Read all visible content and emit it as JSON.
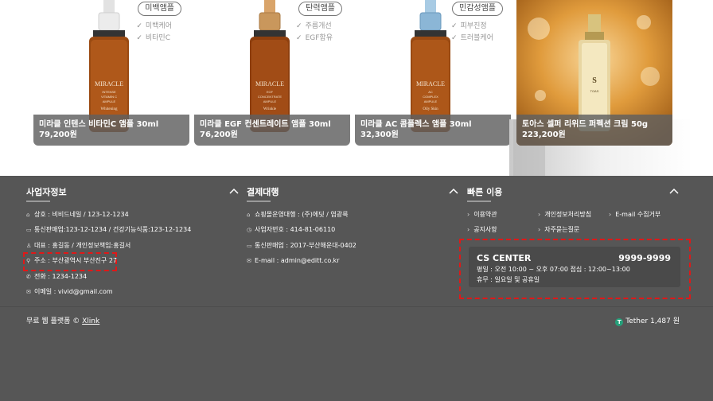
{
  "products": [
    {
      "badge": "미백앰플",
      "features": [
        "미백케어",
        "비타민C"
      ],
      "name": "미라클 인텐스 비타민C 앰플 30ml",
      "price": "79,200원",
      "bottle_label": "MIRACLE INTENSE VITAMIN C AMPULE",
      "bottle_sub": "Whitening",
      "cap_color": "#e8e8e8"
    },
    {
      "badge": "탄력앰플",
      "features": [
        "주름개선",
        "EGF함유"
      ],
      "name": "미라클 EGF 컨센트레이트 앰플 30ml",
      "price": "76,200원",
      "bottle_label": "MIRACLE EGF CONCENTRATE AMPULE",
      "bottle_sub": "Wrinkle",
      "cap_color": "#c9975c"
    },
    {
      "badge": "민감성앰플",
      "features": [
        "피부진정",
        "트러블케어"
      ],
      "name": "미라클 AC 콤플렉스 앰플 30ml",
      "price": "32,300원",
      "bottle_label": "MIRACLE AC COMPLEX AMPULE",
      "bottle_sub": "Oily Skin",
      "cap_color": "#8bb6d6"
    },
    {
      "badge": "",
      "features": [],
      "name": "토아스 셀퍼 리위드 퍼펙션 크림 50g",
      "price": "223,200원",
      "bottle_label": "TOAS",
      "bottle_sub": "",
      "cap_color": "#c7a95a"
    }
  ],
  "footer": {
    "business": {
      "title": "사업자정보",
      "lines": [
        {
          "icon": "home-icon",
          "text": "상호 : 비비드네일 / 123-12-1234"
        },
        {
          "icon": "card-icon",
          "text": "통신판매업:123-12-1234 / 건강기능식품:123-12-1234"
        },
        {
          "icon": "person-icon",
          "text": "대표 : 홍길동 / 개인정보책임:홍길서"
        },
        {
          "icon": "pin-icon",
          "text": "주소 : 부산광역시 부산진구 27"
        },
        {
          "icon": "phone-icon",
          "text": "전화 : 1234-1234"
        },
        {
          "icon": "mail-icon",
          "text": "이메일 : vivid@gmail.com"
        }
      ]
    },
    "settlement": {
      "title": "결제대행",
      "lines": [
        {
          "icon": "home-icon",
          "text": "쇼핑몰운영대행 : (주)에딧 / 염광룩"
        },
        {
          "icon": "clock-icon",
          "text": "사업자번호 : 414-81-06110"
        },
        {
          "icon": "card-icon",
          "text": "통신판매업 : 2017-부산해운대-0402"
        },
        {
          "icon": "mail-icon",
          "text": "E-mail : admin@editt.co.kr"
        }
      ]
    },
    "quick": {
      "title": "빠른 이용",
      "links": [
        "이용약관",
        "개인정보처리방침",
        "E-mail 수집거부",
        "공지사항",
        "자주묻는질문"
      ]
    },
    "cs": {
      "title": "CS CENTER",
      "phone": "9999-9999",
      "hours": "평일 : 오전 10:00 ~ 오후 07:00    점심 : 12:00~13:00",
      "holiday": "휴무 : 일요일 및 공휴일"
    },
    "copyright_prefix": "무료 웹 플랫폼 © ",
    "copyright_link": "Xlink",
    "tether_symbol": "T",
    "tether": "Tether 1,487 원"
  },
  "colors": {
    "footer_bg": "#565656",
    "highlight": "#e01818",
    "tether": "#26a17b"
  }
}
